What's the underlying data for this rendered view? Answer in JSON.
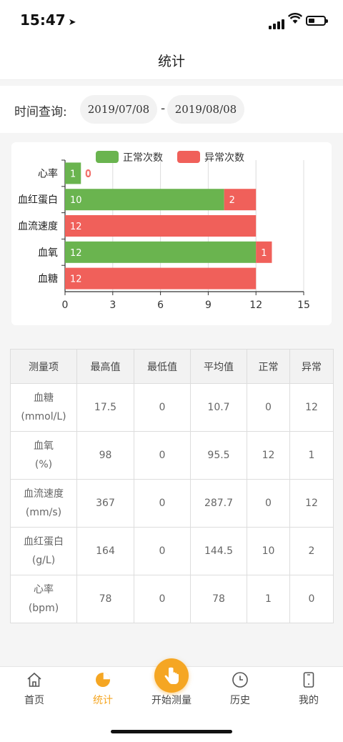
{
  "status": {
    "time": "15:47"
  },
  "nav": {
    "title": "统计"
  },
  "query": {
    "label": "时间查询:",
    "start_date": "2019/07/08",
    "separator": "-",
    "end_date": "2019/08/08"
  },
  "chart_data": {
    "type": "bar",
    "orientation": "horizontal",
    "stacked": true,
    "categories": [
      "心率",
      "血红蛋白",
      "血流速度",
      "血氧",
      "血糖"
    ],
    "series": [
      {
        "name": "正常次数",
        "color": "#6ab44f",
        "values": [
          1,
          10,
          0,
          12,
          0
        ]
      },
      {
        "name": "异常次数",
        "color": "#f0605a",
        "values": [
          0,
          2,
          12,
          1,
          12
        ]
      }
    ],
    "xlim": [
      0,
      15
    ],
    "xticks": [
      0,
      3,
      6,
      9,
      12,
      15
    ],
    "grid": true,
    "legend": "top"
  },
  "table": {
    "headers": [
      "测量项",
      "最高值",
      "最低值",
      "平均值",
      "正常",
      "异常"
    ],
    "rows": [
      {
        "name": "血糖",
        "unit": "(mmol/L)",
        "max": "17.5",
        "min": "0",
        "avg": "10.7",
        "normal": "0",
        "abnormal": "12"
      },
      {
        "name": "血氧",
        "unit": "(%)",
        "max": "98",
        "min": "0",
        "avg": "95.5",
        "normal": "12",
        "abnormal": "1"
      },
      {
        "name": "血流速度",
        "unit": "(mm/s)",
        "max": "367",
        "min": "0",
        "avg": "287.7",
        "normal": "0",
        "abnormal": "12"
      },
      {
        "name": "血红蛋白",
        "unit": "(g/L)",
        "max": "164",
        "min": "0",
        "avg": "144.5",
        "normal": "10",
        "abnormal": "2"
      },
      {
        "name": "心率",
        "unit": "(bpm)",
        "max": "78",
        "min": "0",
        "avg": "78",
        "normal": "1",
        "abnormal": "0"
      }
    ]
  },
  "tabbar": {
    "items": [
      {
        "label": "首页",
        "icon": "home-icon",
        "active": false
      },
      {
        "label": "统计",
        "icon": "pie-chart-icon",
        "active": true
      },
      {
        "label": "开始测量",
        "icon": "tap-hand-icon",
        "active": false
      },
      {
        "label": "历史",
        "icon": "clock-icon",
        "active": false
      },
      {
        "label": "我的",
        "icon": "phone-icon",
        "active": false
      }
    ]
  }
}
